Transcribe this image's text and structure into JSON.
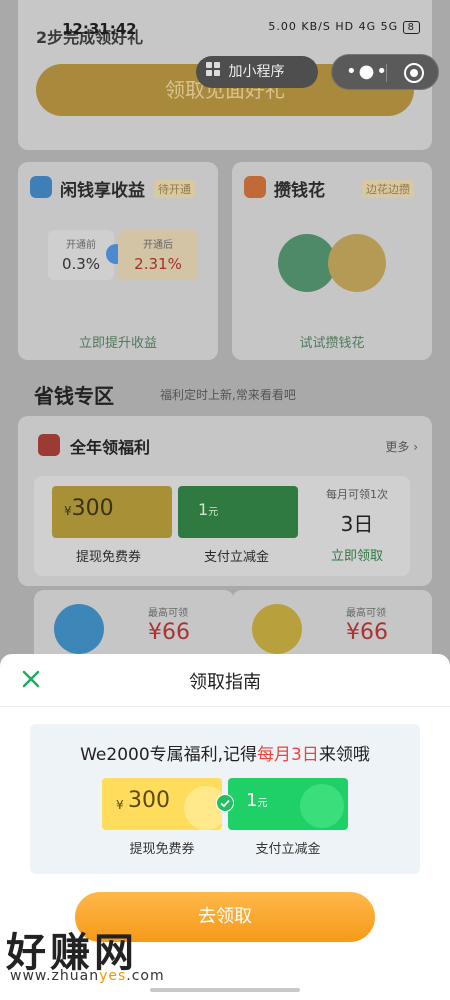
{
  "status_bar": {
    "time": "12:31:42",
    "network_speed": "5.00 KB/S",
    "signals": "HD 4G 5G",
    "battery": "8"
  },
  "header": {
    "step_text": "2步完成领好礼",
    "main_button": "领取见面好礼",
    "mini_program_pill": "加小程序"
  },
  "cards": {
    "left": {
      "title": "闲钱享收益",
      "tag": "待开通",
      "before_label": "开通前",
      "before_value": "0.3%",
      "after_label": "开通后",
      "after_value": "2.31%",
      "footer": "立即提升收益"
    },
    "right": {
      "title": "攒钱花",
      "tag": "边花边攒",
      "footer": "试试攒钱花"
    }
  },
  "section": {
    "title": "省钱专区",
    "subtitle": "福利定时上新,常来看看吧"
  },
  "fuli": {
    "title": "全年领福利",
    "more": "更多",
    "coupon_yellow_currency": "¥",
    "coupon_yellow_amount": "300",
    "coupon_yellow_label": "提现免费券",
    "coupon_green_amount": "1",
    "coupon_green_unit": "元",
    "coupon_green_label": "支付立减金",
    "monthly_text": "每月可领1次",
    "day": "3日",
    "claim_link": "立即领取"
  },
  "mini_cards": [
    {
      "label": "最高可领",
      "value": "¥66"
    },
    {
      "label": "最高可领",
      "value": "¥66"
    }
  ],
  "sheet": {
    "title": "领取指南",
    "guide_prefix": "We2000专属福利,记得",
    "guide_highlight": "每月3日",
    "guide_suffix": "来领哦",
    "coupon_yellow_currency": "¥",
    "coupon_yellow_amount": "300",
    "coupon_yellow_label": "提现免费券",
    "coupon_green_amount": "1",
    "coupon_green_unit": "元",
    "coupon_green_label": "支付立减金",
    "button": "去领取"
  },
  "watermark": {
    "text": "好赚网",
    "url_prefix": "www.zhuan",
    "url_highlight": "yes",
    "url_suffix": ".com"
  },
  "colors": {
    "accent_orange": "#f59a19",
    "wechat_green": "#1fd066",
    "highlight_red": "#e8463c",
    "coupon_yellow": "#ffdc5c"
  }
}
